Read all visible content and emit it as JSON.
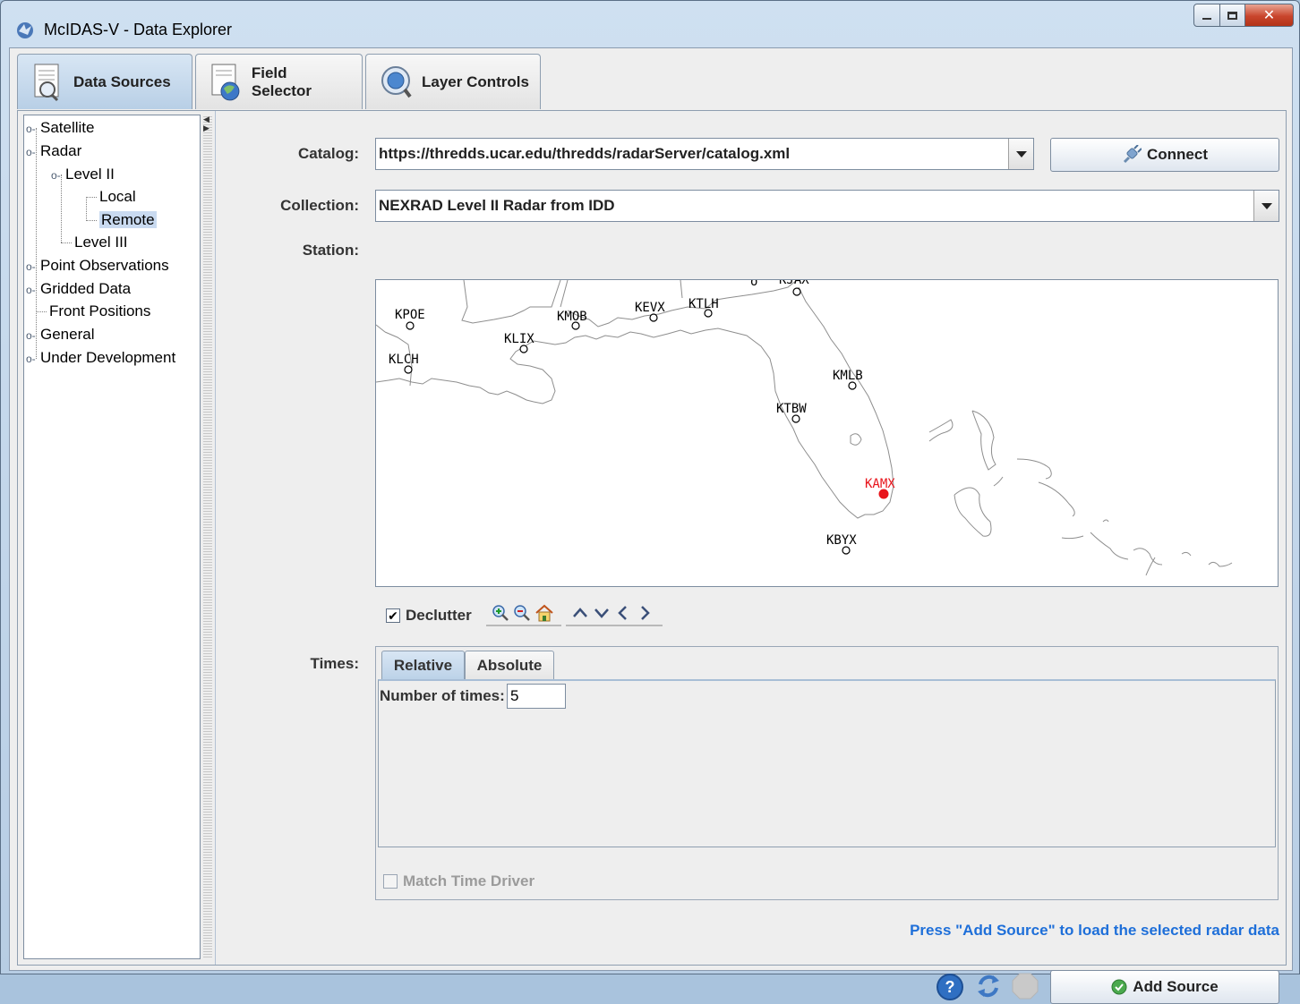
{
  "window": {
    "title": "McIDAS-V - Data Explorer",
    "controls": [
      "minimize",
      "maximize",
      "close"
    ]
  },
  "main_tabs": [
    {
      "label": "Data Sources",
      "active": true
    },
    {
      "label": "Field Selector",
      "active": false
    },
    {
      "label": "Layer Controls",
      "active": false
    }
  ],
  "tree": {
    "items": [
      {
        "label": "Satellite",
        "level": 0,
        "expandable": true
      },
      {
        "label": "Radar",
        "level": 0,
        "expandable": true,
        "expanded": true
      },
      {
        "label": "Level II",
        "level": 1,
        "expandable": true,
        "expanded": true
      },
      {
        "label": "Local",
        "level": 2
      },
      {
        "label": "Remote",
        "level": 2,
        "selected": true
      },
      {
        "label": "Level III",
        "level": 1
      },
      {
        "label": "Point Observations",
        "level": 0,
        "expandable": true
      },
      {
        "label": "Gridded Data",
        "level": 0,
        "expandable": true
      },
      {
        "label": "Front Positions",
        "level": 0
      },
      {
        "label": "General",
        "level": 0,
        "expandable": true
      },
      {
        "label": "Under Development",
        "level": 0,
        "expandable": true
      }
    ]
  },
  "form": {
    "catalog_label": "Catalog:",
    "catalog_value": "https://thredds.ucar.edu/thredds/radarServer/catalog.xml",
    "connect_label": "Connect",
    "collection_label": "Collection:",
    "collection_value": "NEXRAD Level II Radar from IDD",
    "station_label": "Station:",
    "times_label": "Times:"
  },
  "map": {
    "selected_station": "KAMX",
    "selected_color": "#e8141b",
    "stations": [
      "KPOE",
      "KMOB",
      "KEVX",
      "KTLH",
      "KLIX",
      "KLCH",
      "KMLB",
      "KTBW",
      "KAMX",
      "KBYX"
    ]
  },
  "map_toolbar": {
    "declutter_label": "Declutter",
    "declutter_checked": true,
    "zoom_icons": [
      "zoom-in-icon",
      "zoom-out-icon",
      "home-icon"
    ],
    "pan_icons": [
      "pan-up-icon",
      "pan-down-icon",
      "pan-left-icon",
      "pan-right-icon"
    ]
  },
  "times": {
    "tabs": [
      {
        "label": "Relative",
        "active": true
      },
      {
        "label": "Absolute",
        "active": false
      }
    ],
    "number_label": "Number of times:",
    "number_value": "5",
    "match_time_driver_label": "Match Time Driver",
    "match_time_driver_checked": false
  },
  "status_message": "Press \"Add Source\" to load the selected radar data",
  "footer": {
    "add_source_label": "Add Source",
    "icons": [
      "help-icon",
      "refresh-icon",
      "stop-icon"
    ]
  },
  "colors": {
    "accent_blue": "#1e6fd9",
    "selection": "#c9daf0"
  }
}
